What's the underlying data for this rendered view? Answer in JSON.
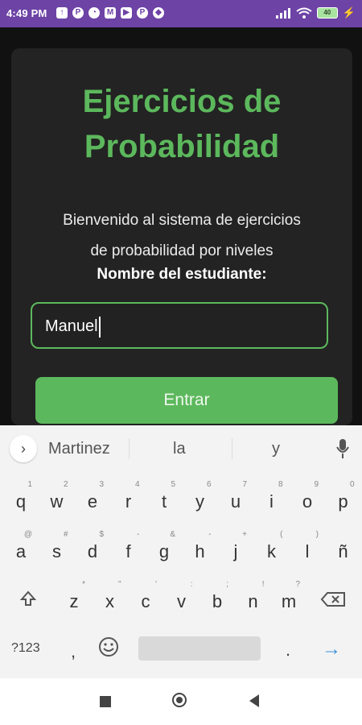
{
  "status_bar": {
    "time": "4:49 PM",
    "battery": "40",
    "notification_icons": [
      "upload-icon",
      "p-icon",
      "cloud-icon",
      "gmail-icon",
      "youtube-icon",
      "p-icon",
      "dropbox-icon"
    ]
  },
  "card": {
    "title_line1": "Ejercicios de",
    "title_line2": "Probabilidad",
    "description_line1": "Bienvenido al sistema de ejercicios",
    "description_line2": "de probabilidad por niveles",
    "student_label": "Nombre del estudiante:",
    "student_input_value": "Manuel",
    "enter_button": "Entrar"
  },
  "keyboard": {
    "suggestions": [
      "Martinez",
      "la",
      "y"
    ],
    "row1": [
      {
        "k": "q",
        "h": "1"
      },
      {
        "k": "w",
        "h": "2"
      },
      {
        "k": "e",
        "h": "3"
      },
      {
        "k": "r",
        "h": "4"
      },
      {
        "k": "t",
        "h": "5"
      },
      {
        "k": "y",
        "h": "6"
      },
      {
        "k": "u",
        "h": "7"
      },
      {
        "k": "i",
        "h": "8"
      },
      {
        "k": "o",
        "h": "9"
      },
      {
        "k": "p",
        "h": "0"
      }
    ],
    "row2": [
      {
        "k": "a",
        "h": "@"
      },
      {
        "k": "s",
        "h": "#"
      },
      {
        "k": "d",
        "h": "$"
      },
      {
        "k": "f",
        "h": "-"
      },
      {
        "k": "g",
        "h": "&"
      },
      {
        "k": "h",
        "h": "-"
      },
      {
        "k": "j",
        "h": "+"
      },
      {
        "k": "k",
        "h": "("
      },
      {
        "k": "l",
        "h": ")"
      },
      {
        "k": "ñ",
        "h": ""
      }
    ],
    "row3": [
      {
        "k": "z",
        "h": "*"
      },
      {
        "k": "x",
        "h": "\""
      },
      {
        "k": "c",
        "h": "'"
      },
      {
        "k": "v",
        "h": ":"
      },
      {
        "k": "b",
        "h": ";"
      },
      {
        "k": "n",
        "h": "!"
      },
      {
        "k": "m",
        "h": "?"
      }
    ],
    "symbols_key": "?123",
    "comma_key": ",",
    "period_key": "."
  },
  "colors": {
    "status_bar": "#6d43a6",
    "accent_green": "#5cb85c",
    "card_bg": "#232323",
    "page_bg": "#111111"
  }
}
